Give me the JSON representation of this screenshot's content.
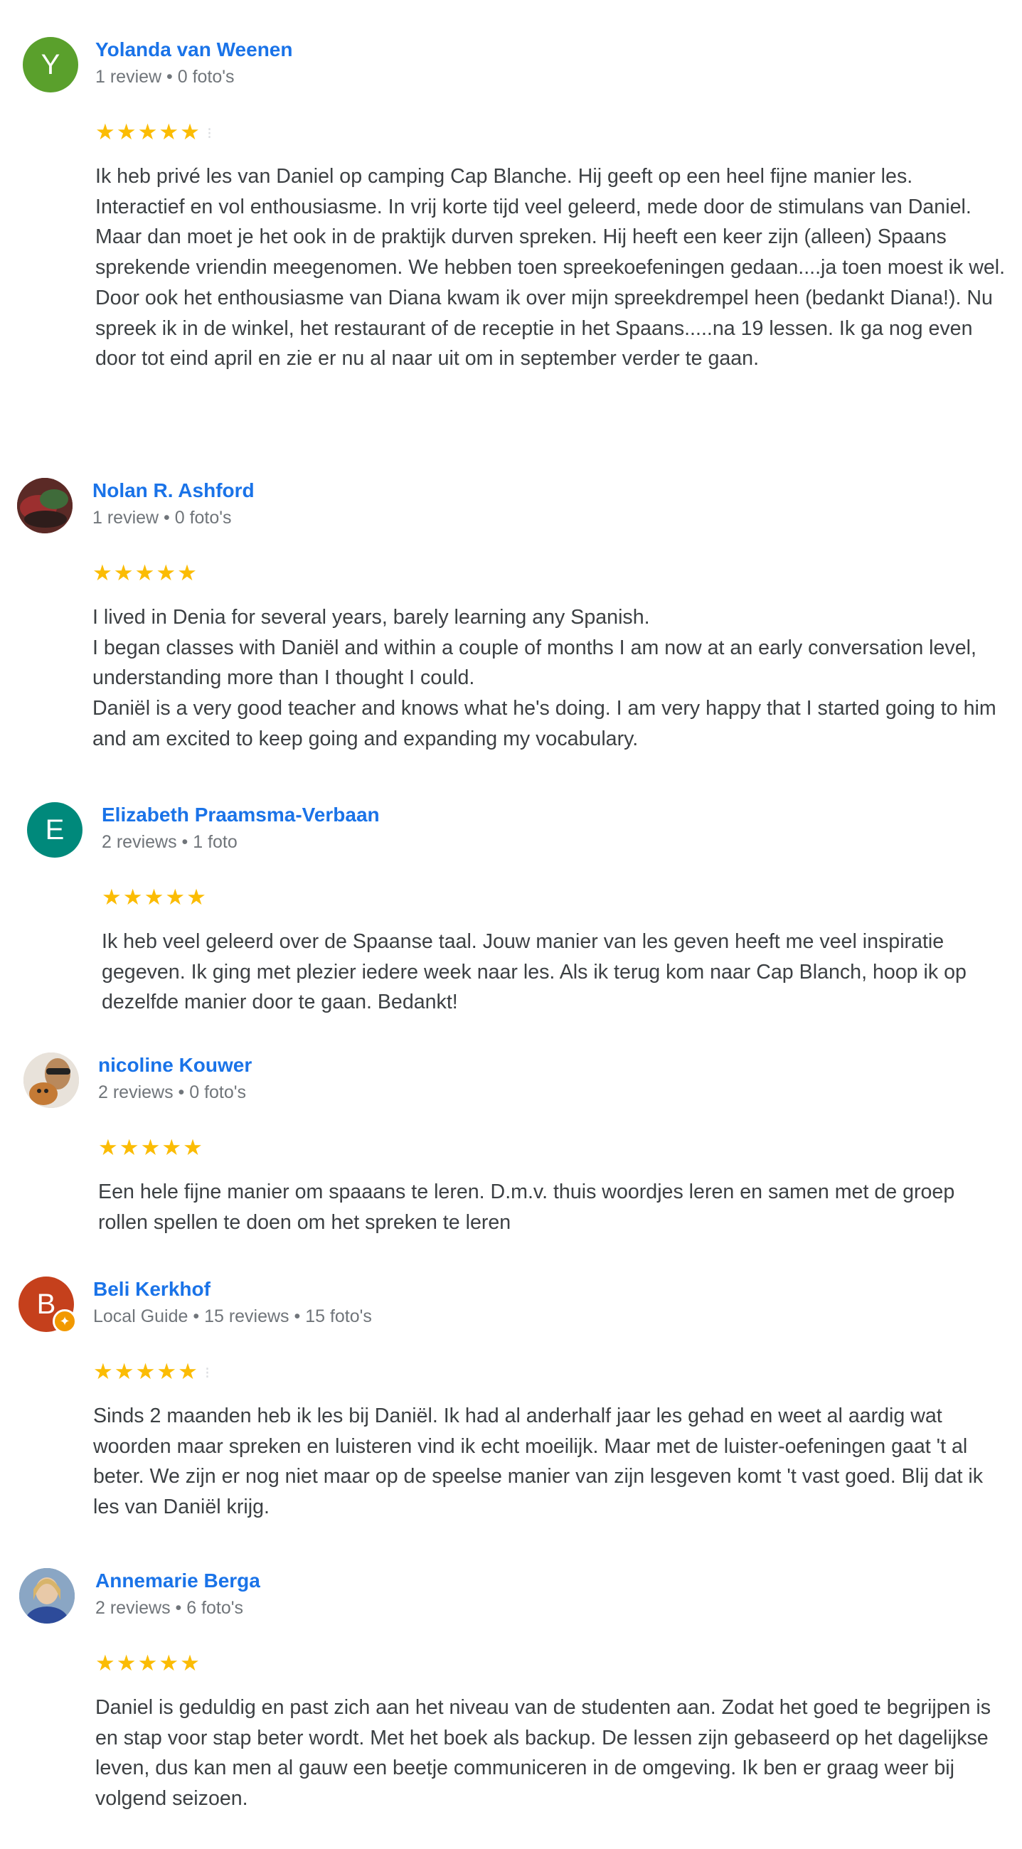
{
  "reviews": [
    {
      "name": "Yolanda van Weenen",
      "meta": "1 review • 0 foto's",
      "avatar_letter": "Y",
      "avatar_color": "#5aa02c",
      "stars": "★★★★★",
      "text": [
        "Ik heb privé les van Daniel op camping Cap Blanche. Hij geeft op een heel fijne manier les. Interactief en vol enthousiasme. In vrij korte tijd veel geleerd, mede door de stimulans van Daniel.",
        "Maar dan moet je het ook in de praktijk durven spreken. Hij heeft een keer zijn (alleen) Spaans sprekende vriendin meegenomen. We hebben toen spreekoefeningen gedaan....ja toen moest ik wel. Door ook het enthousiasme van Diana kwam ik over mijn spreekdrempel heen (bedankt Diana!). Nu spreek ik in de winkel, het restaurant of de receptie in het Spaans.....na 19 lessen. Ik ga nog even door tot eind april en zie er nu al naar uit om in september verder te gaan."
      ]
    },
    {
      "name": "Nolan R. Ashford",
      "meta": "1 review • 0 foto's",
      "avatar_icon": "photo-avatar",
      "stars": "★★★★★",
      "text": [
        "I lived in Denia for several years, barely learning any Spanish.",
        "I began classes with Daniël and within a couple of months I am now at an early conversation level, understanding more than I thought I could.",
        "Daniël is a very good teacher and knows what he's doing. I am very happy that I started going to him and am excited to keep going and expanding my vocabulary."
      ]
    },
    {
      "name": "Elizabeth Praamsma-Verbaan",
      "meta": "2 reviews • 1 foto",
      "avatar_letter": "E",
      "avatar_color": "#00897b",
      "stars": "★★★★★",
      "text": [
        "Ik heb veel geleerd over de Spaanse taal. Jouw manier van les geven heeft me veel inspiratie gegeven. Ik ging met plezier iedere week naar les. Als ik terug kom naar Cap Blanch, hoop ik op dezelfde manier door te gaan. Bedankt!"
      ]
    },
    {
      "name": "nicoline Kouwer",
      "meta": "2 reviews • 0 foto's",
      "avatar_icon": "photo-avatar",
      "stars": "★★★★★",
      "text": [
        "Een hele fijne manier om spaaans te leren. D.m.v. thuis woordjes leren en samen met de groep rollen spellen te doen om het spreken te leren"
      ]
    },
    {
      "name": "Beli Kerkhof",
      "meta": "Local Guide • 15 reviews • 15 foto's",
      "avatar_letter": "B",
      "avatar_color": "#c5401c",
      "stars": "★★★★★",
      "text": [
        "Sinds 2 maanden heb ik les bij Daniël. Ik had al anderhalf jaar les gehad en weet al aardig wat woorden maar spreken en luisteren vind ik echt moeilijk. Maar met de luister-oefeningen gaat 't al beter. We zijn er nog niet maar op de speelse manier van zijn lesgeven komt 't vast goed. Blij dat ik les van Daniël krijg."
      ]
    },
    {
      "name": "Annemarie Berga",
      "meta": "2 reviews • 6 foto's",
      "avatar_icon": "photo-avatar",
      "stars": "★★★★★",
      "text": [
        "Daniel is geduldig en past zich aan het niveau van de studenten aan. Zodat het goed te begrijpen is en stap voor stap beter wordt. Met het boek als backup. De lessen zijn gebaseerd op het dagelijkse leven, dus kan men al gauw een beetje communiceren in de omgeving. Ik ben er graag weer bij volgend seizoen."
      ]
    }
  ],
  "colors": {
    "name": "#1a73e8",
    "meta": "#70757a",
    "star": "#fbbc04",
    "text": "#3c4043"
  }
}
